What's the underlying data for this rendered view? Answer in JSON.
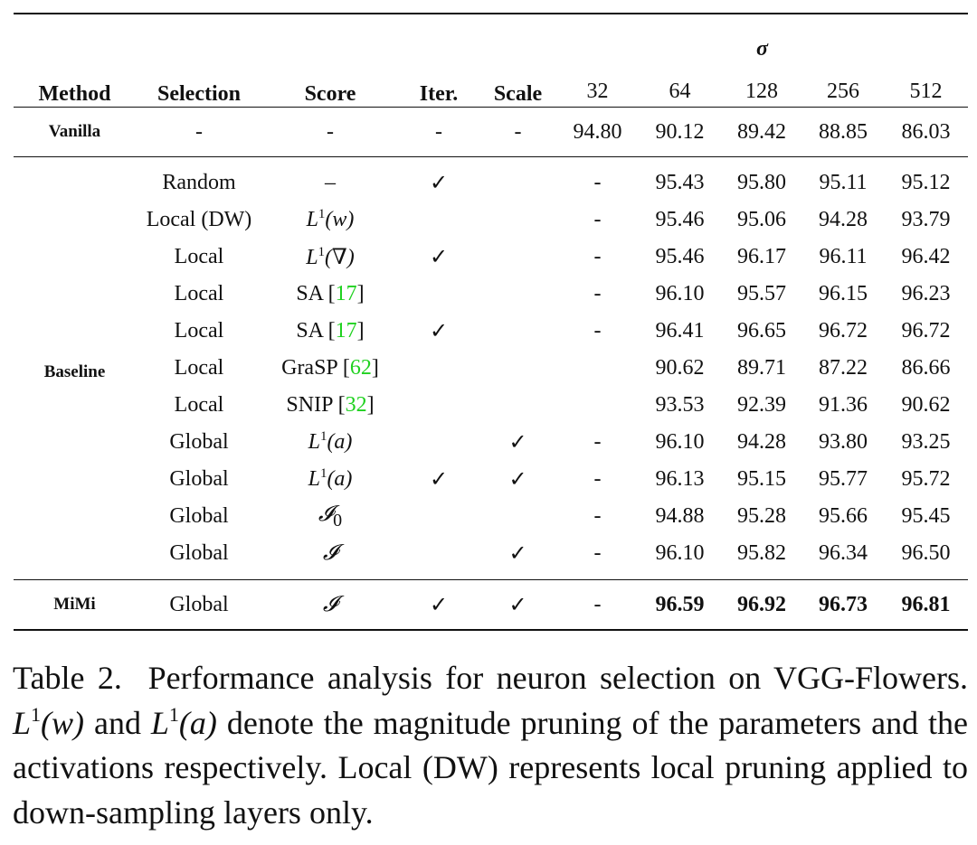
{
  "table": {
    "headers": {
      "method": "Method",
      "selection": "Selection",
      "score": "Score",
      "iter": "Iter.",
      "scale": "Scale",
      "sigma": "σ",
      "sigma_values": [
        "32",
        "64",
        "128",
        "256",
        "512"
      ]
    },
    "vanilla": {
      "method": "Vanilla",
      "selection": "-",
      "score": "-",
      "iter": "-",
      "scale": "-",
      "values": [
        "94.80",
        "90.12",
        "89.42",
        "88.85",
        "86.03"
      ]
    },
    "baseline_label": "Baseline",
    "baseline_rows": [
      {
        "selection": "Random",
        "score": {
          "text": "–"
        },
        "iter": "✓",
        "scale": "",
        "values": [
          "-",
          "95.43",
          "95.80",
          "95.11",
          "95.12"
        ]
      },
      {
        "selection": "Local (DW)",
        "score": {
          "math": "L",
          "sup": "1",
          "arg": "(w)"
        },
        "iter": "",
        "scale": "",
        "values": [
          "-",
          "95.46",
          "95.06",
          "94.28",
          "93.79"
        ]
      },
      {
        "selection": "Local",
        "score": {
          "math": "L",
          "sup": "1",
          "arg": "(∇)"
        },
        "iter": "✓",
        "scale": "",
        "values": [
          "-",
          "95.46",
          "96.17",
          "96.11",
          "96.42"
        ]
      },
      {
        "selection": "Local",
        "score": {
          "text": "SA",
          "ref": "17"
        },
        "iter": "",
        "scale": "",
        "values": [
          "-",
          "96.10",
          "95.57",
          "96.15",
          "96.23"
        ]
      },
      {
        "selection": "Local",
        "score": {
          "text": "SA",
          "ref": "17"
        },
        "iter": "✓",
        "scale": "",
        "values": [
          "-",
          "96.41",
          "96.65",
          "96.72",
          "96.72"
        ]
      },
      {
        "selection": "Local",
        "score": {
          "text": "GraSP",
          "ref": "62"
        },
        "iter": "",
        "scale": "",
        "values": [
          "",
          "90.62",
          "89.71",
          "87.22",
          "86.66"
        ]
      },
      {
        "selection": "Local",
        "score": {
          "text": "SNIP",
          "ref": "32"
        },
        "iter": "",
        "scale": "",
        "values": [
          "",
          "93.53",
          "92.39",
          "91.36",
          "90.62"
        ]
      },
      {
        "selection": "Global",
        "score": {
          "math": "L",
          "sup": "1",
          "arg": "(a)"
        },
        "iter": "",
        "scale": "✓",
        "values": [
          "-",
          "96.10",
          "94.28",
          "93.80",
          "93.25"
        ]
      },
      {
        "selection": "Global",
        "score": {
          "math": "L",
          "sup": "1",
          "arg": "(a)"
        },
        "iter": "✓",
        "scale": "✓",
        "values": [
          "-",
          "96.13",
          "95.15",
          "95.77",
          "95.72"
        ]
      },
      {
        "selection": "Global",
        "score": {
          "math": "𝓘",
          "sub": "0"
        },
        "iter": "",
        "scale": "",
        "values": [
          "-",
          "94.88",
          "95.28",
          "95.66",
          "95.45"
        ]
      },
      {
        "selection": "Global",
        "score": {
          "math": "𝓘"
        },
        "iter": "",
        "scale": "✓",
        "values": [
          "-",
          "96.10",
          "95.82",
          "96.34",
          "96.50"
        ]
      }
    ],
    "mimi": {
      "method": "MiMi",
      "selection": "Global",
      "score": {
        "math": "𝓘"
      },
      "iter": "✓",
      "scale": "✓",
      "values": [
        "-",
        "96.59",
        "96.92",
        "96.73",
        "96.81"
      ]
    },
    "ref_color": "#1fd11f"
  },
  "caption": {
    "label": "Table 2.",
    "t1": "Performance analysis for neuron selection on VGG-Flowers.",
    "m1": {
      "math": "L",
      "sup": "1",
      "arg": "(w)"
    },
    "t2": "and",
    "m2": {
      "math": "L",
      "sup": "1",
      "arg": "(a)"
    },
    "t3": "denote the magnitude pruning of the parameters and the activations respectively. Local (DW) represents local pruning applied to down-sampling layers only."
  }
}
